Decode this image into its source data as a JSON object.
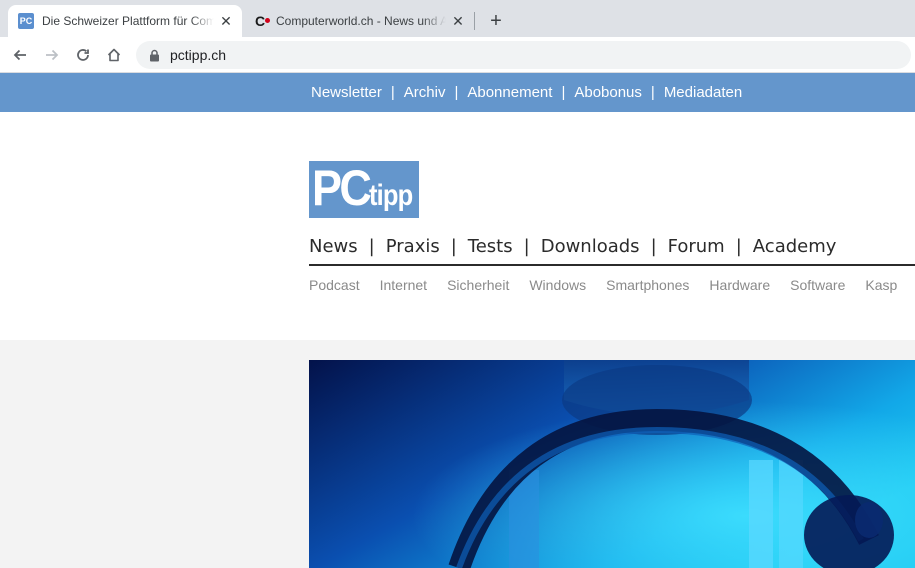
{
  "browser": {
    "tabs": [
      {
        "title": "Die Schweizer Plattform für Computer",
        "favicon": "pctipp-favicon",
        "active": true
      },
      {
        "title": "Computerworld.ch - News und Analysen",
        "favicon": "computerworld-favicon",
        "active": false
      }
    ],
    "new_tab_icon": "plus-icon",
    "address": {
      "url": "pctipp.ch",
      "secure": true
    }
  },
  "site": {
    "topbar": {
      "items": [
        "Newsletter",
        "Archiv",
        "Abonnement",
        "Abobonus",
        "Mediadaten"
      ],
      "separator": "|"
    },
    "logo": {
      "text_pc": "PC",
      "text_tipp": "tipp",
      "color": "#6496cc"
    },
    "main_nav": {
      "items": [
        "News",
        "Praxis",
        "Tests",
        "Downloads",
        "Forum",
        "Academy"
      ],
      "separator": "|"
    },
    "sub_nav": {
      "items": [
        "Podcast",
        "Internet",
        "Sicherheit",
        "Windows",
        "Smartphones",
        "Hardware",
        "Software",
        "Kasp"
      ]
    }
  },
  "colors": {
    "brand_blue": "#6496cc",
    "tabstrip": "#dee1e6",
    "content_bg": "#f3f3f3"
  }
}
